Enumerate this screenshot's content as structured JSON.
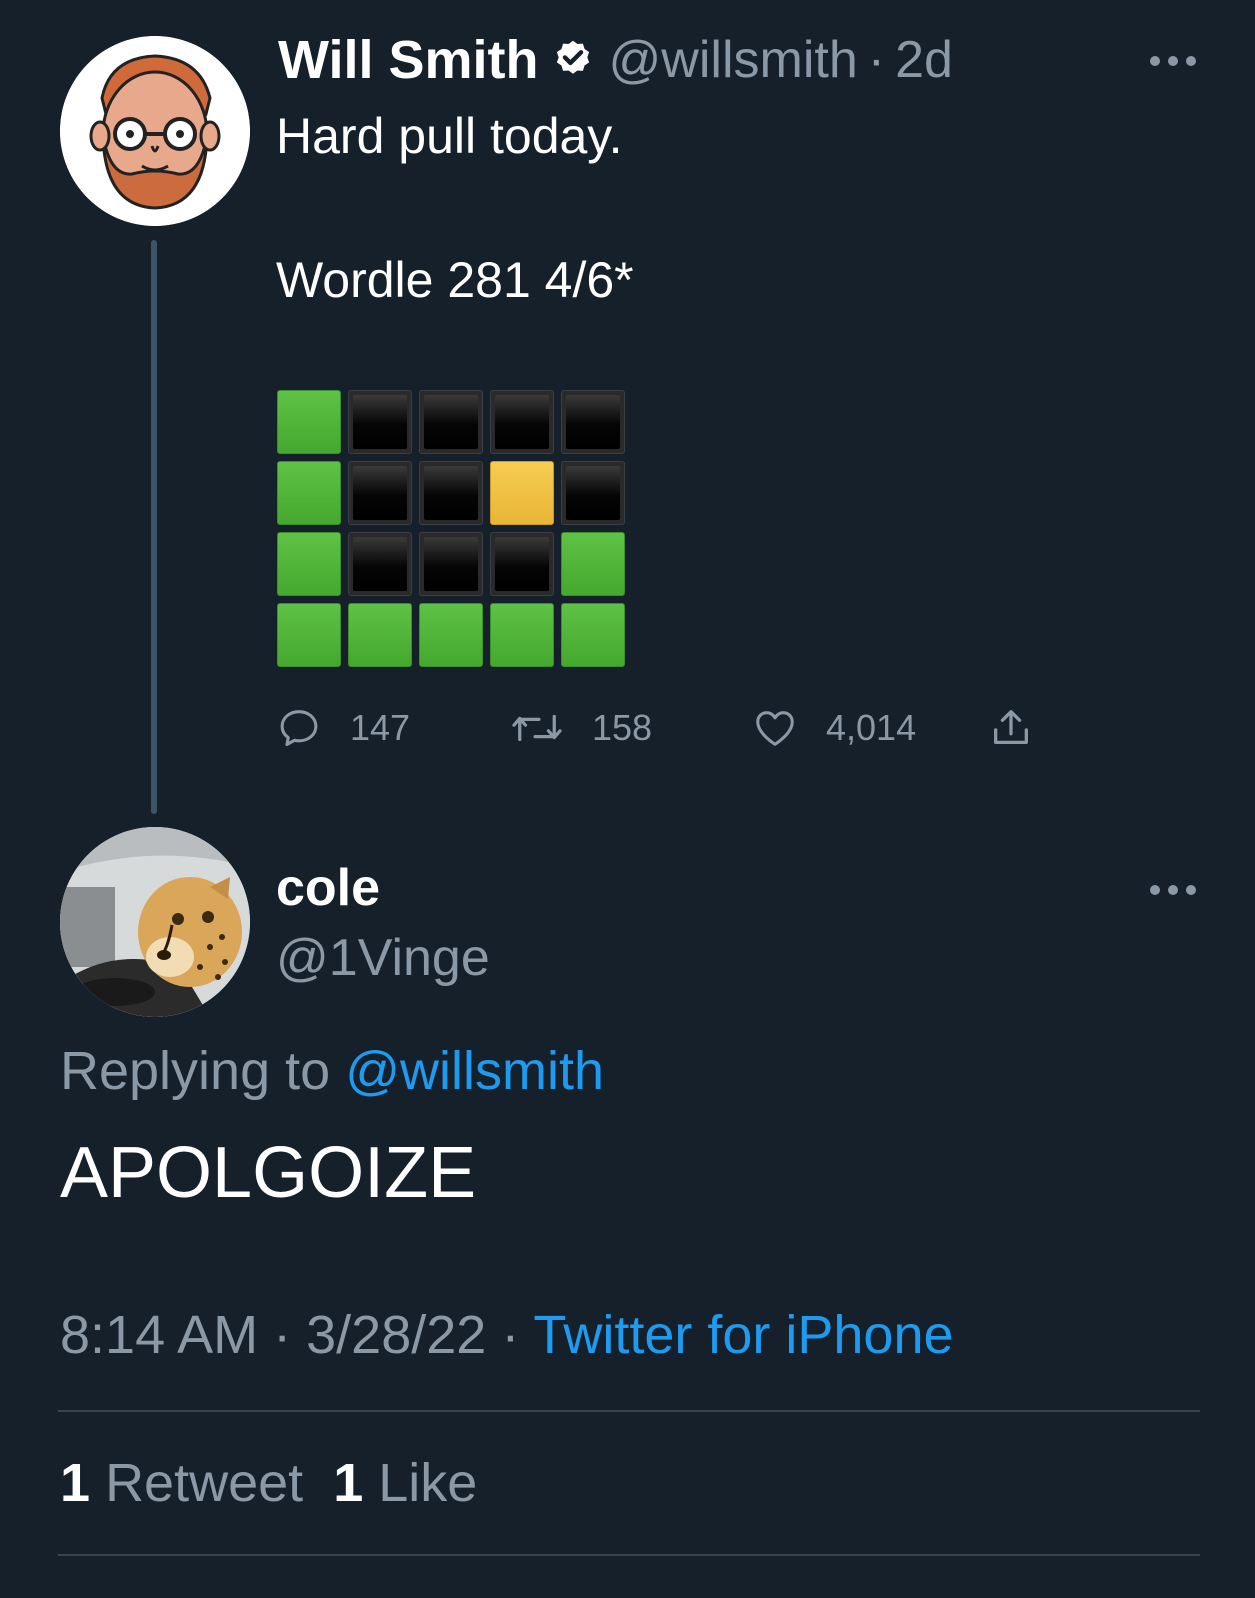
{
  "parent_tweet": {
    "author_name": "Will Smith",
    "verified": true,
    "handle": "@willsmith",
    "separator": "·",
    "time": "2d",
    "text": "Hard pull today.",
    "wordle_line": "Wordle 281 4/6*",
    "wordle_grid": [
      [
        "green",
        "black",
        "black",
        "black",
        "black"
      ],
      [
        "green",
        "black",
        "black",
        "yellow",
        "black"
      ],
      [
        "green",
        "black",
        "black",
        "black",
        "green"
      ],
      [
        "green",
        "green",
        "green",
        "green",
        "green"
      ]
    ],
    "replies": "147",
    "retweets": "158",
    "likes": "4,014",
    "icons": [
      "more-icon",
      "verified-icon",
      "reply-icon",
      "retweet-icon",
      "like-icon",
      "share-icon"
    ]
  },
  "reply_tweet": {
    "author_name": "cole",
    "handle": "@1Vinge",
    "replying_prefix": "Replying to",
    "replying_to": "@willsmith",
    "text": "APOLGOIZE",
    "time": "8:14 AM",
    "sep1": "·",
    "date": "3/28/22",
    "sep2": "·",
    "source": "Twitter for iPhone",
    "retweet_count": "1",
    "retweet_label": "Retweet",
    "like_count": "1",
    "like_label": "Like"
  },
  "colors": {
    "background": "#15202b",
    "secondary_text": "#8b98a5",
    "link": "#1d9bf0",
    "wordle_green": "#4caf36",
    "wordle_yellow": "#eebf40"
  }
}
